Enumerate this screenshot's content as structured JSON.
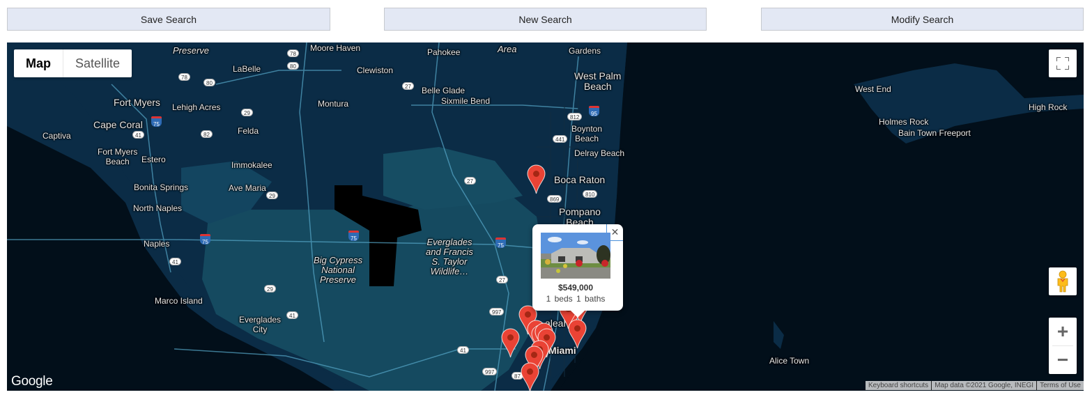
{
  "toolbar": {
    "save_label": "Save Search",
    "new_label": "New Search",
    "modify_label": "Modify Search"
  },
  "map": {
    "map_type": {
      "map_label": "Map",
      "satellite_label": "Satellite",
      "selected": "Map"
    },
    "controls": {
      "fullscreen_icon": "fullscreen-icon",
      "pegman_icon": "pegman-icon",
      "zoom_in": "+",
      "zoom_out": "−"
    },
    "logo": "Google",
    "attribution": {
      "keyboard": "Keyboard shortcuts",
      "data": "Map data ©2021 Google, INEGI",
      "terms": "Terms of Use"
    },
    "labels": {
      "ranch_preserve": "Preserve",
      "moore_haven": "Moore Haven",
      "pahokee": "Pahokee",
      "area": "Area",
      "pb_gardens": "Gardens",
      "labelle": "LaBelle",
      "clewiston": "Clewiston",
      "west_palm": "West Palm",
      "west_palm2": "Beach",
      "belle_glade": "Belle Glade",
      "sixmile": "Sixmile Bend",
      "fort_myers": "Fort Myers",
      "lehigh": "Lehigh Acres",
      "montura": "Montura",
      "cape_coral": "Cape Coral",
      "felda": "Felda",
      "boynton": "Boynton",
      "boynton2": "Beach",
      "captiva": "Captiva",
      "fm_beach": "Fort Myers",
      "fm_beach2": "Beach",
      "estero": "Estero",
      "delray": "Delray Beach",
      "immokalee": "Immokalee",
      "bonita": "Bonita Springs",
      "ave_maria": "Ave Maria",
      "boca": "Boca Raton",
      "north_naples": "North Naples",
      "pompano": "Pompano",
      "pompano2": "Beach",
      "naples": "Naples",
      "big_cypress": "Big Cypress",
      "big_cypress2": "National",
      "big_cypress3": "Preserve",
      "everglades_wl": "Everglades",
      "everglades_wl2": "and Francis",
      "everglades_wl3": "S. Taylor",
      "everglades_wl4": "Wildlife…",
      "marco": "Marco Island",
      "ev_city": "Everglades",
      "ev_city2": "City",
      "hialeah": "aleah",
      "miami": "Miami",
      "west_end": "West End",
      "high_rock": "High Rock",
      "holmes_rock": "Holmes Rock",
      "bain_town": "Bain Town Freeport",
      "alice_town": "Alice Town"
    },
    "shields": [
      "78",
      "80",
      "78",
      "80",
      "27",
      "29",
      "82",
      "41",
      "95",
      "812",
      "441",
      "27",
      "869",
      "810",
      "29",
      "41",
      "29",
      "41",
      "27",
      "41",
      "997",
      "997",
      "87"
    ],
    "interstates": [
      "75",
      "75",
      "75",
      "95"
    ],
    "info_window": {
      "price": "$549,000",
      "beds": "1 beds",
      "baths": "1 baths"
    },
    "markers_count": 14
  }
}
